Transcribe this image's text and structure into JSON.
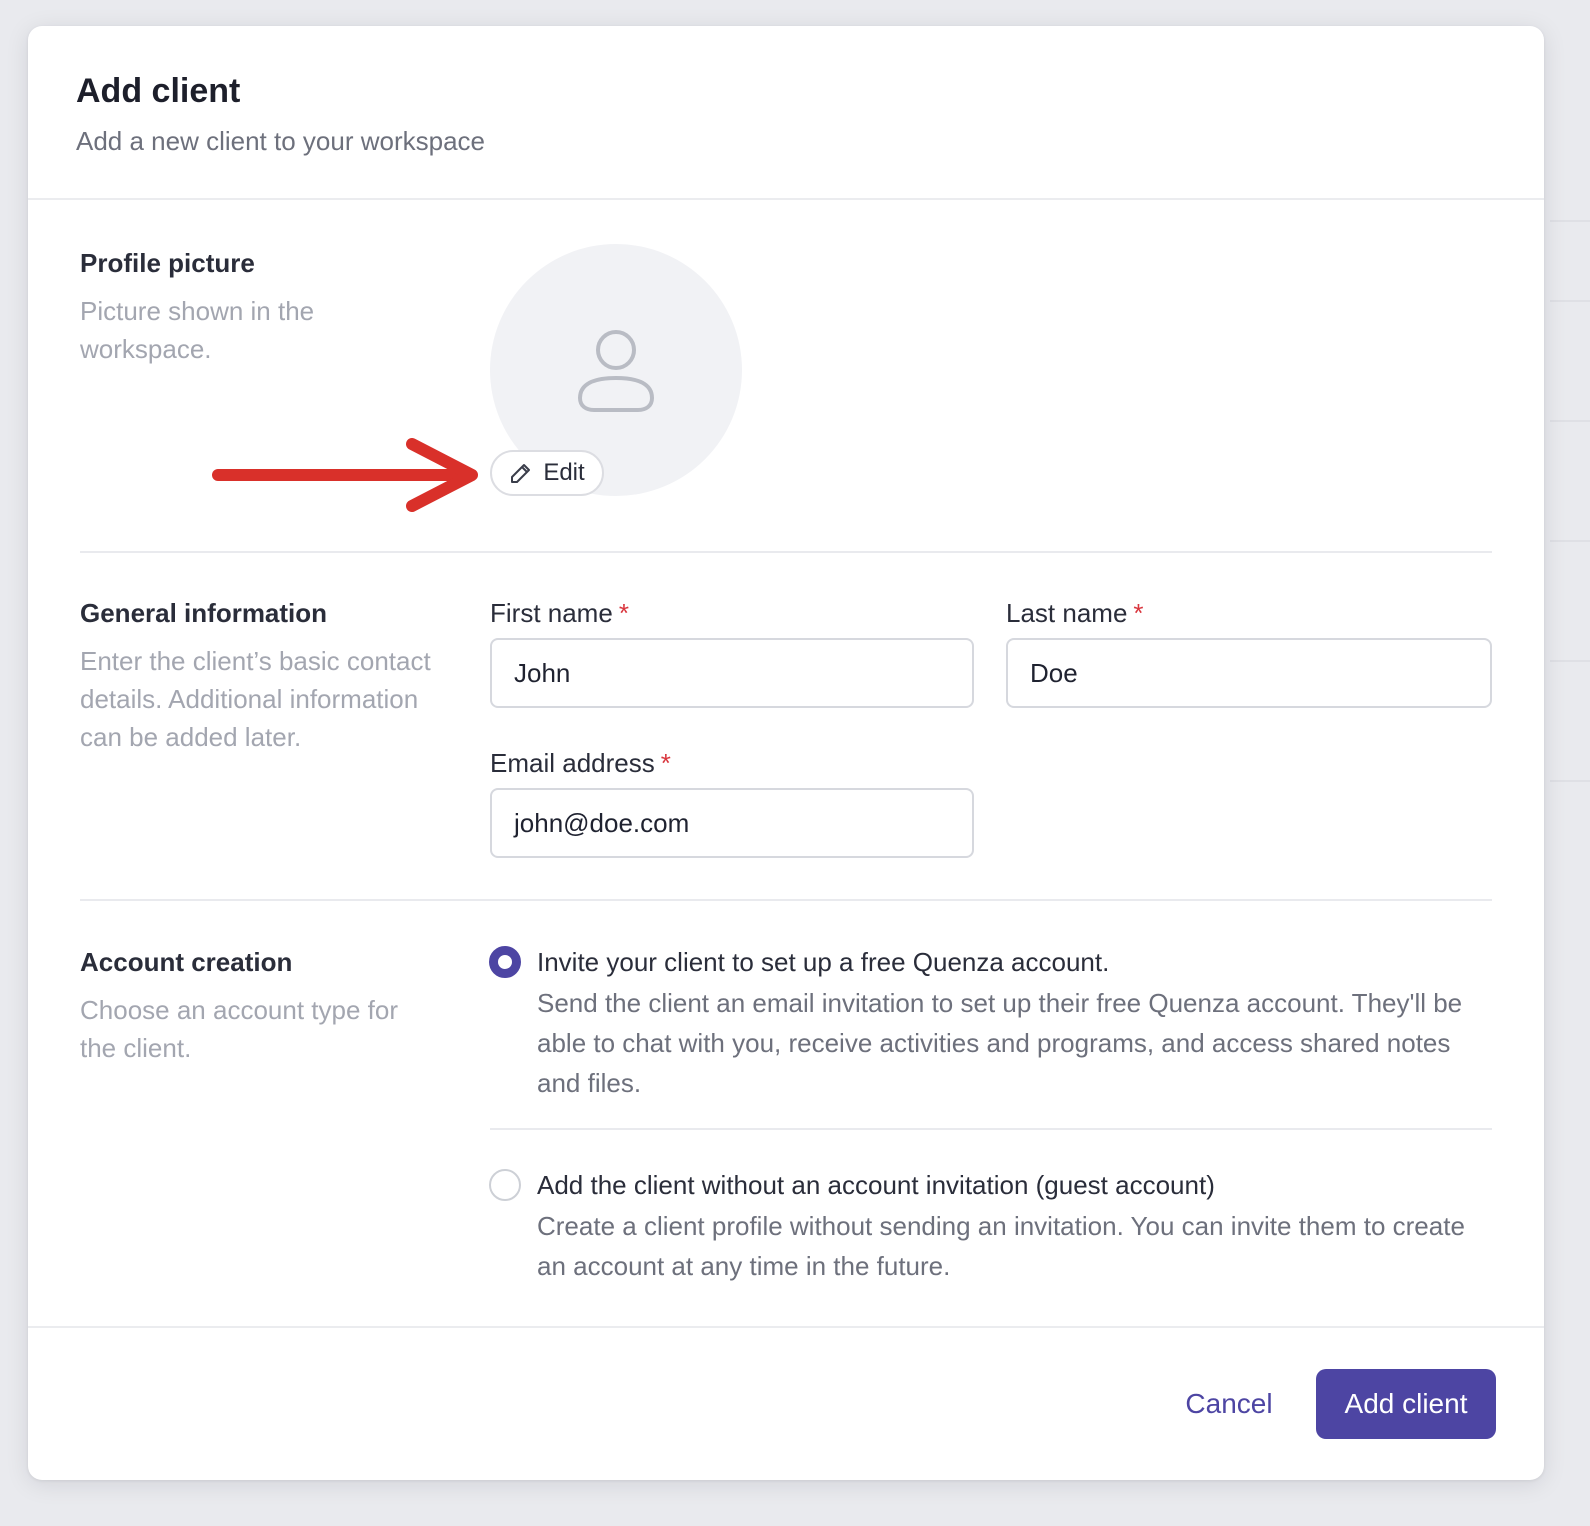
{
  "modal": {
    "title": "Add client",
    "subtitle": "Add a new client to your workspace"
  },
  "profile_picture": {
    "title": "Profile picture",
    "description": "Picture shown in the workspace.",
    "edit_label": "Edit",
    "avatar_icon": "user-icon",
    "edit_icon": "pencil-icon",
    "annotation": "red-arrow"
  },
  "general_information": {
    "title": "General information",
    "description": "Enter the client’s basic contact details. Additional information can be added later.",
    "first_name": {
      "label": "First name",
      "required_mark": "*",
      "value": "John"
    },
    "last_name": {
      "label": "Last name",
      "required_mark": "*",
      "value": "Doe"
    },
    "email": {
      "label": "Email address",
      "required_mark": "*",
      "value": "john@doe.com"
    }
  },
  "account_creation": {
    "title": "Account creation",
    "description": "Choose an account type for the client.",
    "options": [
      {
        "title": "Invite your client to set up a free Quenza account.",
        "description": "Send the client an email invitation to set up their free Quenza account. They'll be able to chat with you, receive activities and programs, and access shared notes and files.",
        "selected": true
      },
      {
        "title": "Add the client without an account invitation (guest account)",
        "description": "Create a client profile without sending an invitation. You can invite them to create an account at any time in the future.",
        "selected": false
      }
    ]
  },
  "footer": {
    "cancel_label": "Cancel",
    "submit_label": "Add client"
  },
  "colors": {
    "accent": "#4d45a3",
    "required": "#d9363e",
    "annotation_arrow": "#d9302a"
  }
}
